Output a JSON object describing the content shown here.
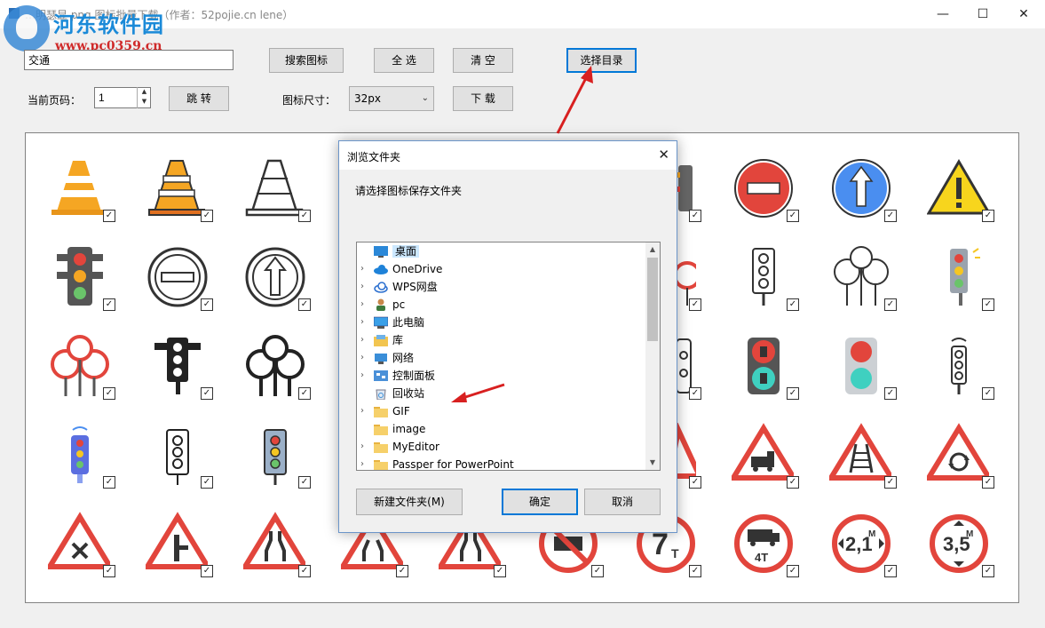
{
  "window": {
    "title": "…明瑟显 png 图标批量下载（作者：52pojie.cn lene）",
    "minimize": "—",
    "maximize": "☐",
    "close": "✕"
  },
  "watermark": {
    "name": "河东软件园",
    "url": "www.pc0359.cn"
  },
  "toolbar": {
    "search_value": "交通",
    "search_button": "搜索图标",
    "select_all_button": "全 选",
    "clear_button": "清 空",
    "choose_dir_button": "选择目录",
    "page_label": "当前页码：",
    "page_value": "1",
    "jump_button": "跳 转",
    "size_label": "图标尺寸：",
    "size_value": "32px",
    "download_button": "下 载"
  },
  "colors": {
    "accent": "#0078d7",
    "red": "#e2453c",
    "orange": "#f5a623",
    "arrow": "#d82020"
  },
  "icons": [
    {
      "name": "traffic-cone-orange",
      "checked": true
    },
    {
      "name": "traffic-cone-striped",
      "checked": true
    },
    {
      "name": "traffic-cone-outline",
      "checked": true
    },
    {
      "name": "traffic-light-partial",
      "checked": true
    },
    {
      "name": "no-entry-sign",
      "checked": true
    },
    {
      "name": "ahead-only-sign",
      "checked": true
    },
    {
      "name": "warning-sign",
      "checked": true
    },
    {
      "name": "traffic-light-color",
      "checked": true
    },
    {
      "name": "no-entry-outline",
      "checked": true
    },
    {
      "name": "ahead-only-outline",
      "checked": true
    },
    {
      "name": "turn-sign-partial",
      "checked": true
    },
    {
      "name": "traffic-light-outline",
      "checked": true
    },
    {
      "name": "direction-signs-outline",
      "checked": true
    },
    {
      "name": "traffic-light-gray",
      "checked": true
    },
    {
      "name": "direction-signs-red",
      "checked": true
    },
    {
      "name": "traffic-light-black",
      "checked": true
    },
    {
      "name": "direction-signs-black",
      "checked": true
    },
    {
      "name": "traffic-light-small-partial",
      "checked": true
    },
    {
      "name": "pedestrian-signal",
      "checked": true
    },
    {
      "name": "traffic-light-red-green",
      "checked": true
    },
    {
      "name": "smart-traffic-light",
      "checked": true
    },
    {
      "name": "wifi-traffic-light",
      "checked": true
    },
    {
      "name": "traffic-light-line",
      "checked": true
    },
    {
      "name": "traffic-light-blue",
      "checked": true
    },
    {
      "name": "triangle-sign-partial",
      "checked": true
    },
    {
      "name": "train-warning-sign",
      "checked": true
    },
    {
      "name": "railway-crossing-sign",
      "checked": true
    },
    {
      "name": "roundabout-sign",
      "checked": true
    },
    {
      "name": "crossroad-sign",
      "checked": true
    },
    {
      "name": "side-road-sign",
      "checked": true
    },
    {
      "name": "road-narrows-sign",
      "checked": true
    },
    {
      "name": "road-narrows-sign-2",
      "checked": true
    },
    {
      "name": "road-narrows-sign-3",
      "checked": true
    },
    {
      "name": "no-trucks-sign",
      "checked": true
    },
    {
      "name": "weight-limit-sign",
      "checked": true
    },
    {
      "name": "truck-weight-sign",
      "checked": true
    },
    {
      "name": "width-limit-sign",
      "checked": true
    },
    {
      "name": "height-limit-sign",
      "checked": true
    }
  ],
  "sign_text": {
    "weight": "7",
    "weight_unit": "T",
    "truck_weight": "4T",
    "width": "2,1",
    "width_unit": "M",
    "height": "3,5",
    "height_unit": "M"
  },
  "dialog": {
    "title": "浏览文件夹",
    "close": "✕",
    "prompt": "请选择图标保存文件夹",
    "tree": [
      {
        "label": "桌面",
        "icon": "desktop-icon",
        "selected": true,
        "expandable": false
      },
      {
        "label": "OneDrive",
        "icon": "cloud-icon",
        "selected": false,
        "expandable": true
      },
      {
        "label": "WPS网盘",
        "icon": "cloud-outline-icon",
        "selected": false,
        "expandable": true
      },
      {
        "label": "pc",
        "icon": "user-icon",
        "selected": false,
        "expandable": true
      },
      {
        "label": "此电脑",
        "icon": "computer-icon",
        "selected": false,
        "expandable": true
      },
      {
        "label": "库",
        "icon": "library-icon",
        "selected": false,
        "expandable": true
      },
      {
        "label": "网络",
        "icon": "network-icon",
        "selected": false,
        "expandable": true
      },
      {
        "label": "控制面板",
        "icon": "control-panel-icon",
        "selected": false,
        "expandable": true
      },
      {
        "label": "回收站",
        "icon": "recycle-bin-icon",
        "selected": false,
        "expandable": false
      },
      {
        "label": "GIF",
        "icon": "folder-icon",
        "selected": false,
        "expandable": true
      },
      {
        "label": "image",
        "icon": "folder-icon",
        "selected": false,
        "expandable": false
      },
      {
        "label": "MyEditor",
        "icon": "folder-icon",
        "selected": false,
        "expandable": true
      },
      {
        "label": "Passper for PowerPoint",
        "icon": "folder-icon",
        "selected": false,
        "expandable": true
      }
    ],
    "new_folder_button": "新建文件夹(M)",
    "ok_button": "确定",
    "cancel_button": "取消"
  }
}
